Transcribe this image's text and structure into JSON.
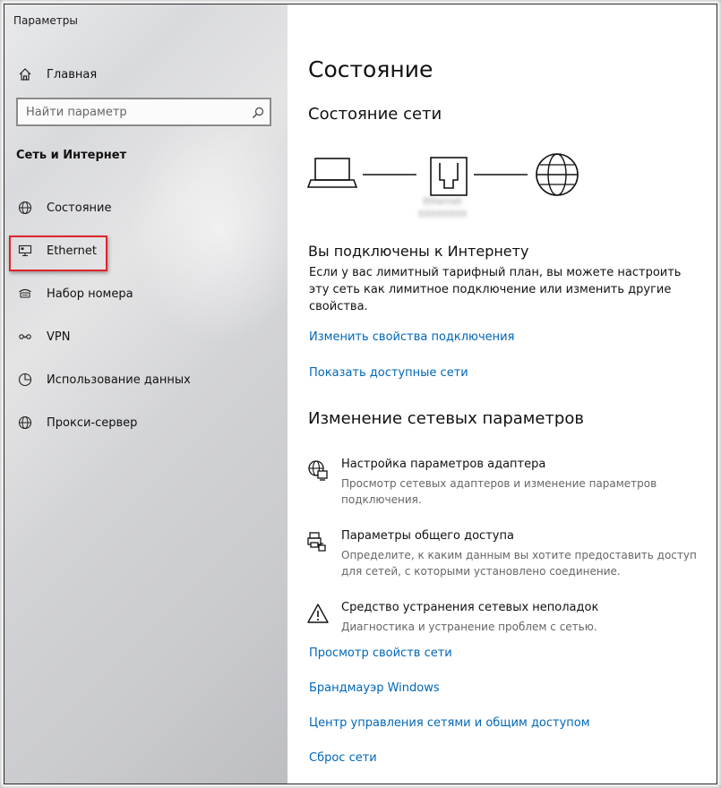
{
  "app": {
    "title": "Параметры"
  },
  "sidebar": {
    "home_label": "Главная",
    "search_placeholder": "Найти параметр",
    "section_title": "Сеть и Интернет",
    "items": [
      {
        "label": "Состояние",
        "icon": "globe-icon"
      },
      {
        "label": "Ethernet",
        "icon": "ethernet-icon"
      },
      {
        "label": "Набор номера",
        "icon": "dialup-icon"
      },
      {
        "label": "VPN",
        "icon": "vpn-icon"
      },
      {
        "label": "Использование данных",
        "icon": "data-usage-icon"
      },
      {
        "label": "Прокси-сервер",
        "icon": "globe-icon"
      }
    ]
  },
  "main": {
    "title": "Состояние",
    "network_status_heading": "Состояние сети",
    "blurred_adapter_label": "Ethernet\nXXXXXXXX",
    "connected_heading": "Вы подключены к Интернету",
    "connected_text": "Если у вас лимитный тарифный план, вы можете настроить эту сеть как лимитное подключение или изменить другие свойства.",
    "links_top": [
      "Изменить свойства подключения",
      "Показать доступные сети"
    ],
    "change_heading": "Изменение сетевых параметров",
    "options": [
      {
        "title": "Настройка параметров адаптера",
        "description": "Просмотр сетевых адаптеров и изменение параметров подключения.",
        "icon": "adapter-icon"
      },
      {
        "title": "Параметры общего доступа",
        "description": "Определите, к каким данным вы хотите предоставить доступ для сетей, с которыми установлено соединение.",
        "icon": "sharing-icon"
      },
      {
        "title": "Средство устранения сетевых неполадок",
        "description": "Диагностика и устранение проблем с сетью.",
        "icon": "warning-icon"
      }
    ],
    "links_bottom": [
      "Просмотр свойств сети",
      "Брандмауэр Windows",
      "Центр управления сетями и общим доступом",
      "Сброс сети"
    ]
  },
  "colors": {
    "link": "#0067b8",
    "highlight": "#e0242b"
  }
}
